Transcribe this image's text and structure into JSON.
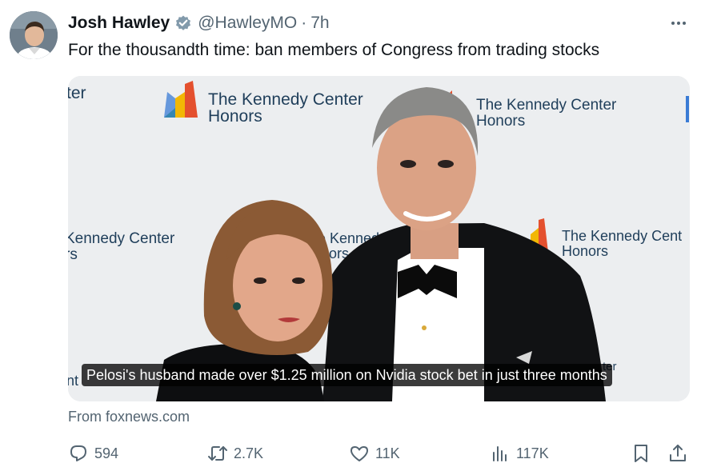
{
  "tweet": {
    "display_name": "Josh Hawley",
    "handle": "@HawleyMO",
    "separator": "·",
    "time": "7h",
    "verified_icon": "verified-badge-icon",
    "text": "For the thousandth time: ban members of Congress from trading stocks"
  },
  "card": {
    "caption": "Pelosi's husband made over $1.25 million on Nvidia stock bet in just three months",
    "source": "From foxnews.com",
    "backdrop_text": {
      "line1": "The Kennedy Center",
      "line2": "Honors",
      "fragment_er": "ter",
      "fragment_left1": "Kennedy Center",
      "fragment_left2": "rs",
      "fragment_mid1": "e Kenned",
      "fragment_mid2": "nors",
      "fragment_right1": "The Kennedy Cent",
      "fragment_bottom": "nt",
      "fragment_bottom_right": "ter"
    }
  },
  "actions": {
    "replies": "594",
    "reposts": "2.7K",
    "likes": "11K",
    "views": "117K"
  },
  "colors": {
    "text_primary": "#0f1419",
    "text_secondary": "#536471",
    "verified": "#829aab"
  }
}
